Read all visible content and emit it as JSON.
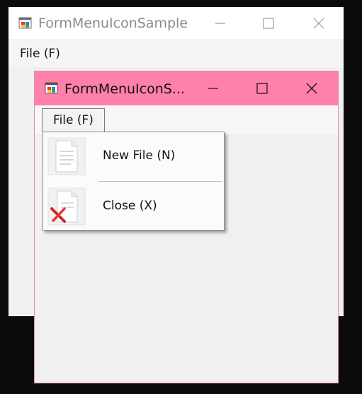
{
  "back_window": {
    "title": "FormMenuIconSample",
    "menu": {
      "file_label": "File (F)"
    }
  },
  "front_window": {
    "title": "FormMenuIconS...",
    "menu": {
      "file_label": "File (F)"
    },
    "title_bar_color": "#ff80aa",
    "dropdown": {
      "items": [
        {
          "label": "New File (N)",
          "icon": "new-file-icon"
        },
        {
          "label": "Close (X)",
          "icon": "close-file-icon"
        }
      ]
    }
  },
  "icons": {
    "minimize": "minimize-icon",
    "maximize": "maximize-icon",
    "close": "close-icon",
    "app": "form-app-icon"
  }
}
